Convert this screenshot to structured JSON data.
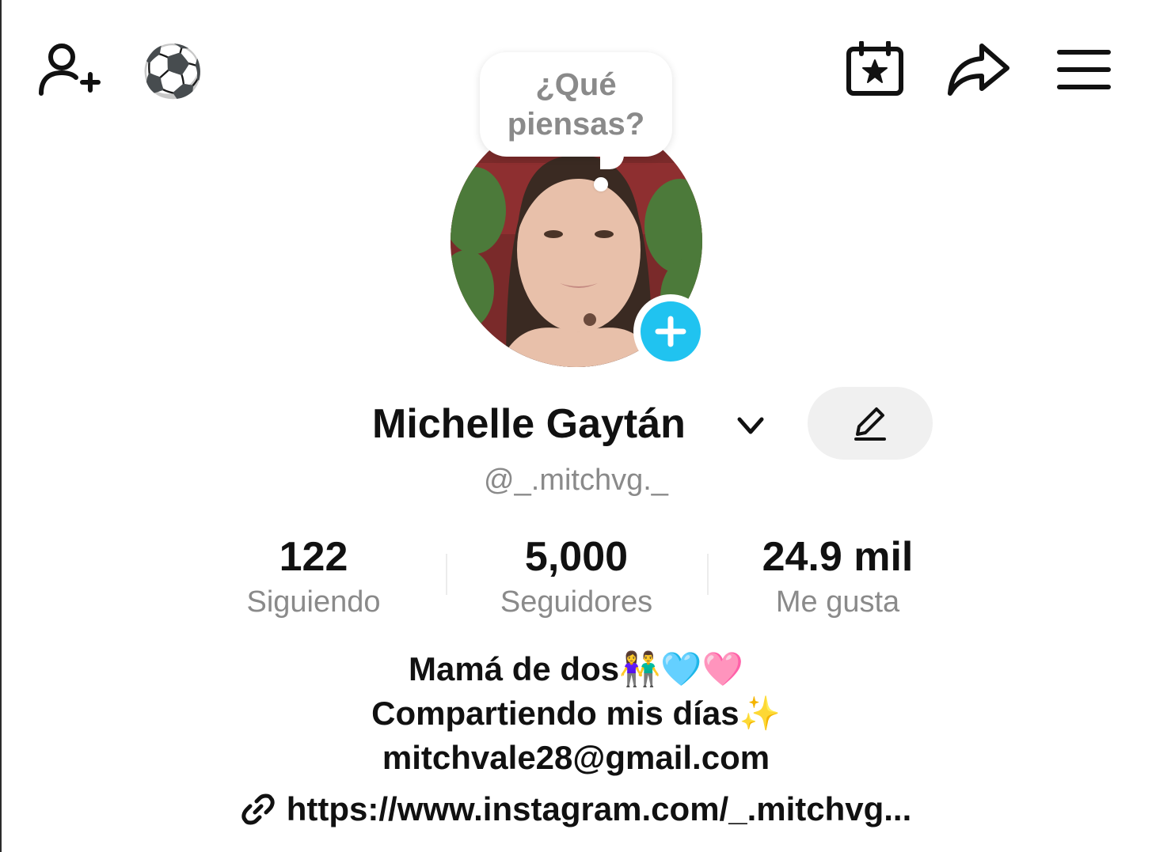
{
  "header": {
    "add_friend_icon": "person-plus-icon",
    "badge_emoji": "⚽",
    "calendar_icon": "calendar-star-icon",
    "share_icon": "share-arrow-icon",
    "menu_icon": "hamburger-menu-icon"
  },
  "bubble": {
    "text": "¿Qué piensas?"
  },
  "profile": {
    "name": "Michelle Gaytán",
    "handle": "@_.mitchvg._",
    "accent_color": "#20c3f0"
  },
  "stats": [
    {
      "value": "122",
      "label": "Siguiendo"
    },
    {
      "value": "5,000",
      "label": "Seguidores"
    },
    {
      "value": "24.9 mil",
      "label": "Me gusta"
    }
  ],
  "bio": {
    "line1_text": "Mamá de dos",
    "line1_emoji": "👫🩵🩷",
    "line2_text": "Compartiendo mis días",
    "line2_emoji": "✨",
    "line3": "mitchvale28@gmail.com",
    "link": "https://www.instagram.com/_.mitchvg..."
  }
}
